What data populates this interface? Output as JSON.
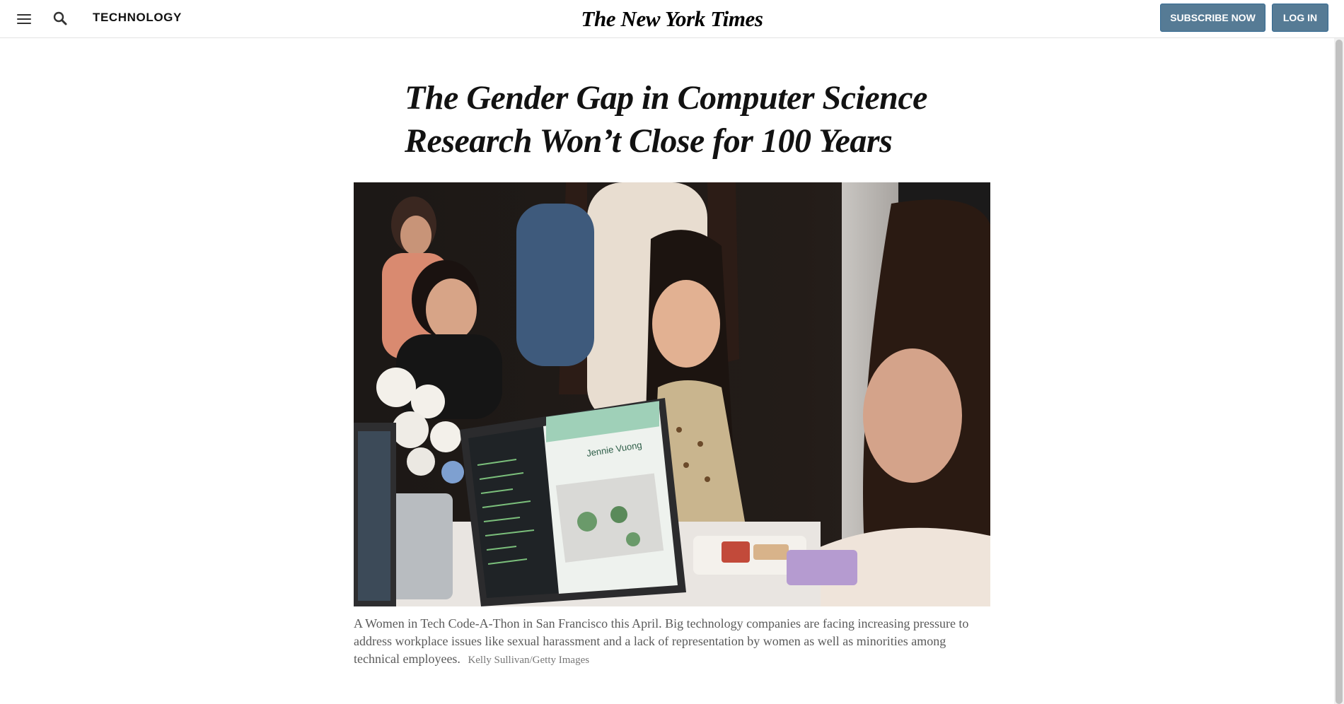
{
  "header": {
    "section": "TECHNOLOGY",
    "logo": "The New York Times",
    "subscribe_label": "SUBSCRIBE NOW",
    "login_label": "LOG IN"
  },
  "article": {
    "headline": "The Gender Gap in Computer Science Research Won’t Close for 100 Years",
    "caption": "A Women in Tech Code-A-Thon in San Francisco this April. Big technology companies are facing increasing pressure to address workplace issues like sexual harassment and a lack of representation by women as well as minorities among technical employees.",
    "credit": "Kelly Sullivan/Getty Images",
    "photo_screen_text": "Jennie Vuong"
  },
  "colors": {
    "button_bg": "#567b95",
    "button_border": "#326891",
    "text_primary": "#121212",
    "caption_text": "#5a5a5a"
  },
  "icons": [
    "menu-icon",
    "search-icon"
  ]
}
